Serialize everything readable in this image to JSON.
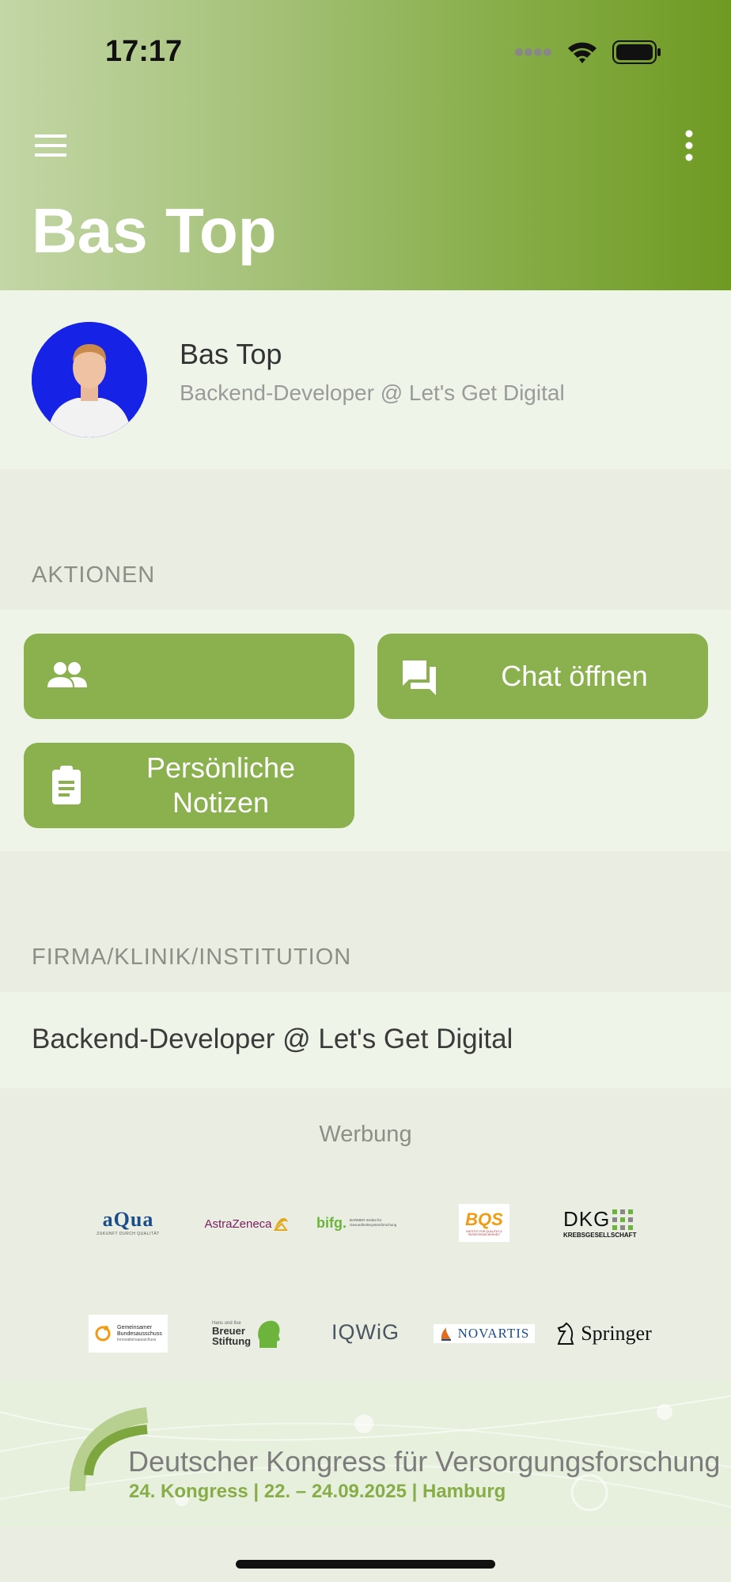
{
  "status_bar": {
    "time": "17:17",
    "icons": [
      "signal-icon",
      "wifi-icon",
      "battery-icon"
    ]
  },
  "header": {
    "title": "Bas Top",
    "menu_icon": "hamburger-menu-icon",
    "more_icon": "more-vertical-icon"
  },
  "profile": {
    "name": "Bas Top",
    "subtitle": "Backend-Developer @ Let's Get Digital"
  },
  "sections": {
    "actions_label": "AKTIONEN",
    "company_label": "FIRMA/KLINIK/INSTITUTION"
  },
  "actions": [
    {
      "label": "",
      "icon": "people-icon"
    },
    {
      "label": "Chat öffnen",
      "icon": "chat-icon"
    },
    {
      "label": "Persönliche Notizen",
      "icon": "clipboard-icon"
    }
  ],
  "company": {
    "text": "Backend-Developer @ Let's Get Digital"
  },
  "ads": {
    "label": "Werbung",
    "logos": [
      {
        "main": "aQua",
        "sub": "ZUKUNFT DURCH QUALITÄT"
      },
      {
        "main": "AstraZeneca"
      },
      {
        "main": "bifg.",
        "sub": "BARMER Institut für Gesundheitssystemforschung"
      },
      {
        "main": "BQS",
        "sub": "INSTITUT FÜR QUALITÄT & PATIENTENSICHERHEIT"
      },
      {
        "main": "DKG",
        "sub": "KREBSGESELLSCHAFT"
      },
      {
        "main": "Gemeinsamer Bundesausschuss",
        "sub": "Innovationsausschuss"
      },
      {
        "main": "Breuer Stiftung",
        "sub": "Hans und Ilse"
      },
      {
        "main": "IQWiG"
      },
      {
        "main": "NOVARTIS"
      },
      {
        "main": "Springer"
      }
    ]
  },
  "banner": {
    "title": "Deutscher Kongress für Versorgungsforschung",
    "subtitle": "24. Kongress | 22. – 24.09.2025 | Hamburg"
  },
  "colors": {
    "accent": "#8ab14d",
    "header_dark": "#6f9a22",
    "header_light": "#c3d6a6"
  }
}
